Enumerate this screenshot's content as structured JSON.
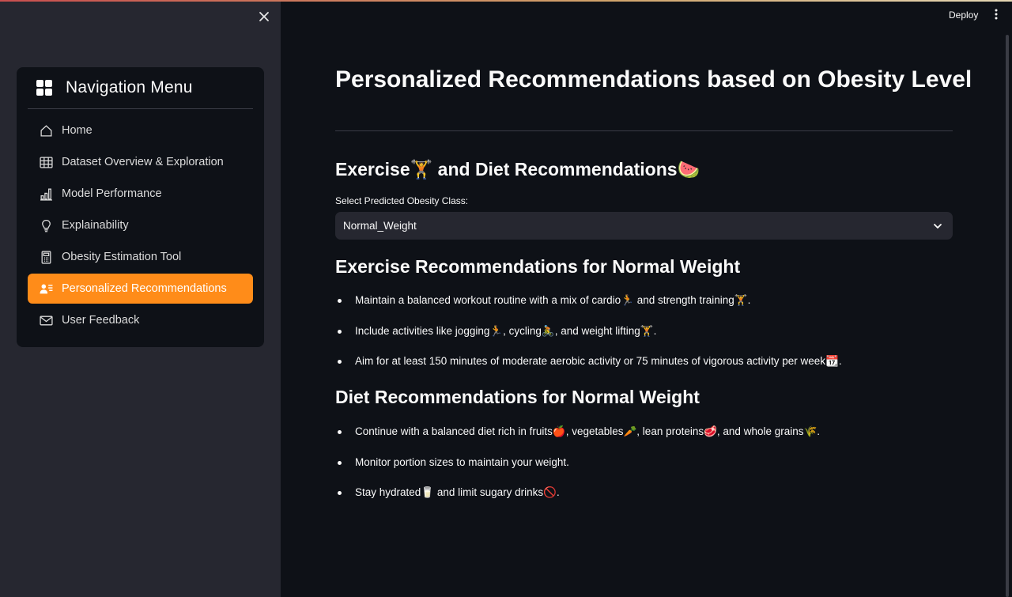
{
  "sidebar": {
    "close_icon": "close-icon",
    "nav_title": "Navigation Menu",
    "items": [
      {
        "label": "Home",
        "icon": "home-icon"
      },
      {
        "label": "Dataset Overview & Exploration",
        "icon": "table-icon"
      },
      {
        "label": "Model Performance",
        "icon": "bar-chart-icon"
      },
      {
        "label": "Explainability",
        "icon": "lightbulb-icon"
      },
      {
        "label": "Obesity Estimation Tool",
        "icon": "calculator-icon"
      },
      {
        "label": "Personalized Recommendations",
        "icon": "person-lines-icon",
        "active": true
      },
      {
        "label": "User Feedback",
        "icon": "envelope-icon"
      }
    ],
    "active_color": "#ff8c19"
  },
  "header": {
    "deploy_label": "Deploy",
    "menu_icon": "kebab-menu-icon"
  },
  "main": {
    "title": "Personalized Recommendations based on Obesity Level",
    "section_heading": "Exercise🏋️ and Diet Recommendations🍉",
    "select": {
      "label": "Select Predicted Obesity Class:",
      "value": "Normal_Weight"
    },
    "exercise": {
      "heading": "Exercise Recommendations for Normal Weight",
      "items": [
        "Maintain a balanced workout routine with a mix of cardio🏃 and strength training🏋️.",
        "Include activities like jogging🏃, cycling🚴, and weight lifting🏋️.",
        "Aim for at least 150 minutes of moderate aerobic activity or 75 minutes of vigorous activity per week📆."
      ]
    },
    "diet": {
      "heading": "Diet Recommendations for Normal Weight",
      "items": [
        "Continue with a balanced diet rich in fruits🍎, vegetables🥕, lean proteins🥩, and whole grains🌾.",
        "Monitor portion sizes to maintain your weight.",
        "Stay hydrated🥛 and limit sugary drinks🚫."
      ]
    }
  }
}
